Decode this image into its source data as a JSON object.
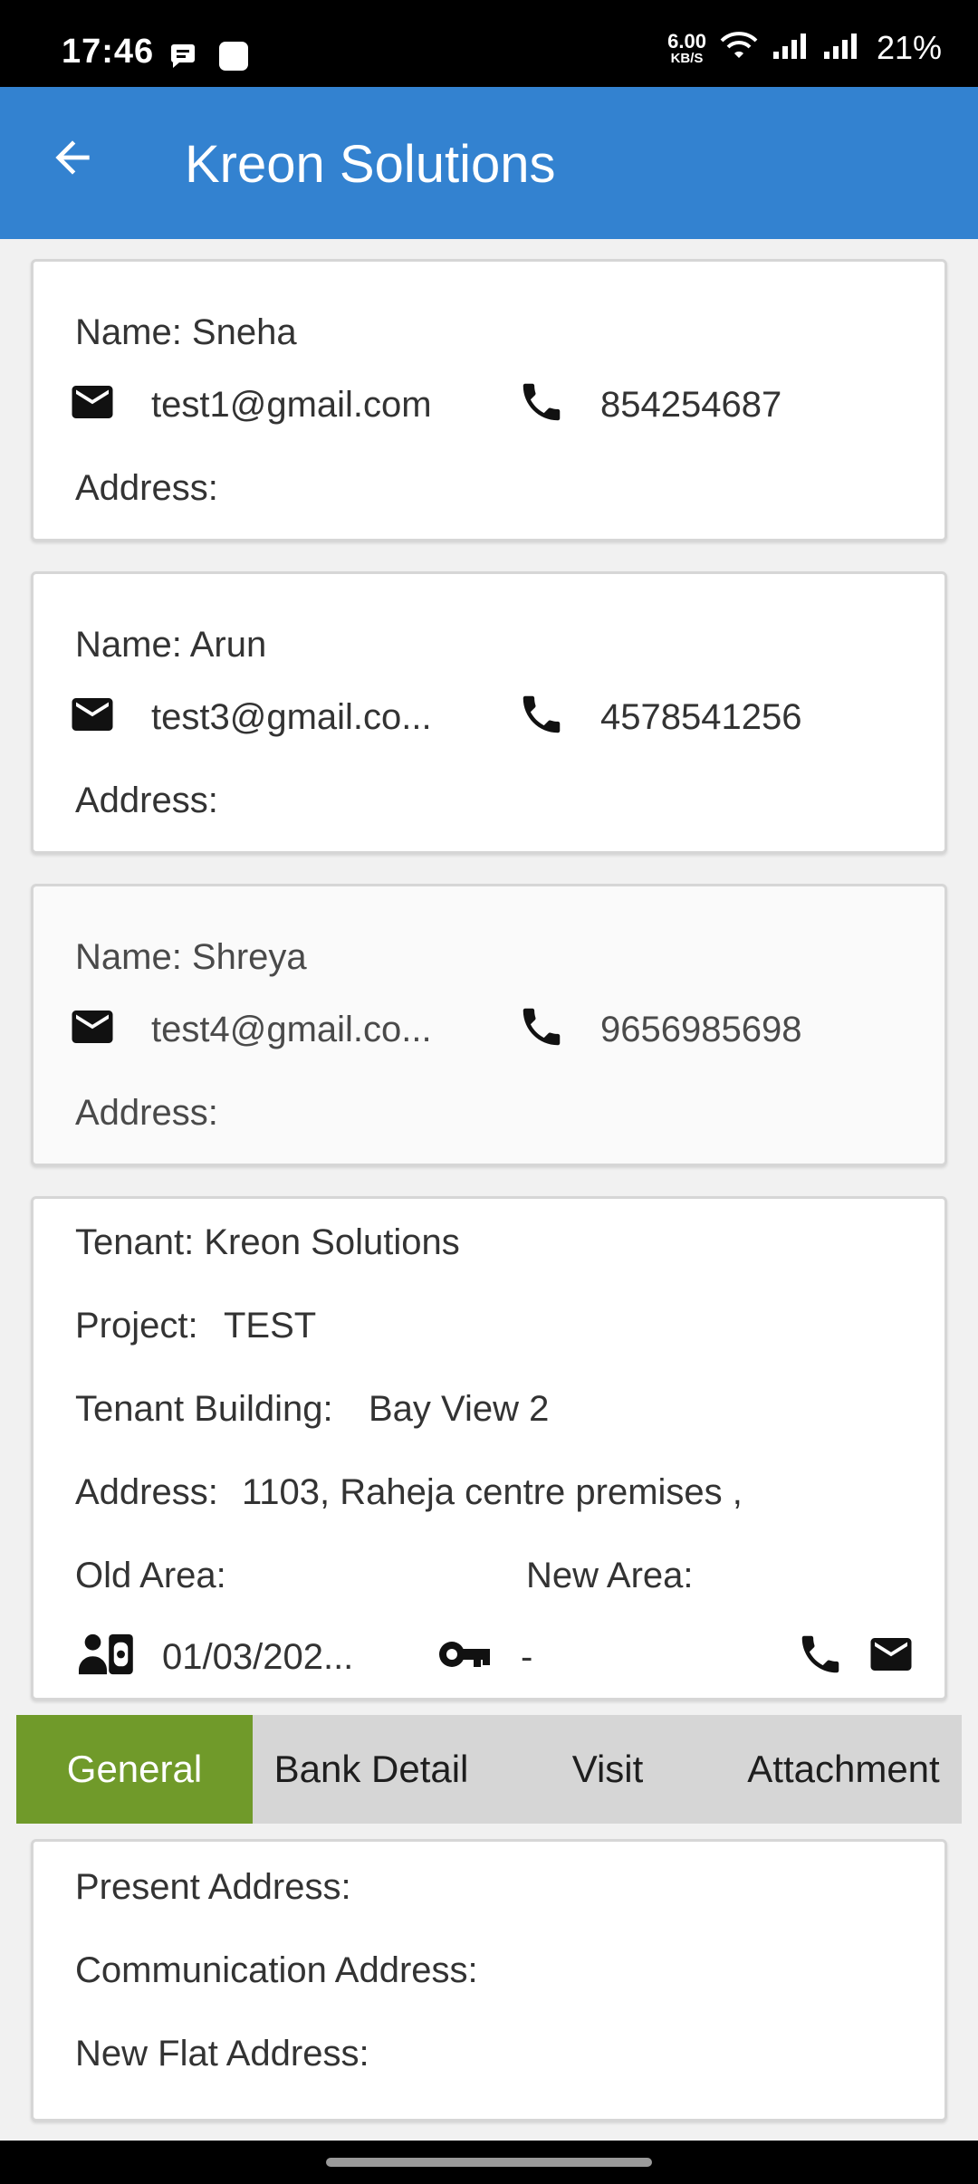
{
  "status_bar": {
    "time": "17:46",
    "net_speed_value": "6.00",
    "net_speed_unit": "KB/S",
    "battery": "21%",
    "icons": [
      "chat-notification-icon",
      "square-notification-icon",
      "wifi-icon",
      "signal-icon",
      "signal-icon"
    ]
  },
  "app_bar": {
    "title": "Kreon Solutions",
    "back_icon": "arrow-left-icon",
    "color": "#3382d0"
  },
  "contacts": [
    {
      "name_label": "Name: Sneha",
      "email": "test1@gmail.com",
      "phone": "854254687",
      "address_label": "Address:"
    },
    {
      "name_label": "Name: Arun",
      "email": "test3@gmail.co...",
      "phone": "4578541256",
      "address_label": "Address:"
    },
    {
      "name_label": "Name: Shreya",
      "email": "test4@gmail.co...",
      "phone": "9656985698",
      "address_label": "Address:"
    }
  ],
  "tenant": {
    "tenant_label": "Tenant: Kreon Solutions",
    "project_label": "Project:",
    "project_value": "TEST",
    "building_label": "Tenant Building:",
    "building_value": "Bay View 2",
    "address_label": "Address:",
    "address_value": "1103, Raheja centre premises ,",
    "old_area_label": "Old Area:",
    "new_area_label": "New Area:",
    "date_value": "01/03/202...",
    "key_value": "-"
  },
  "tabs": [
    {
      "label": "General",
      "active": true
    },
    {
      "label": "Bank Detail",
      "active": false
    },
    {
      "label": "Visit",
      "active": false
    },
    {
      "label": "Attachment",
      "active": false
    }
  ],
  "general": {
    "present_address": "Present Address:",
    "communication_address": "Communication Address:",
    "new_flat_address": "New Flat Address:"
  },
  "colors": {
    "accent": "#3382d0",
    "active_tab": "#709a2a",
    "tab_bg": "#d6d6d6"
  }
}
